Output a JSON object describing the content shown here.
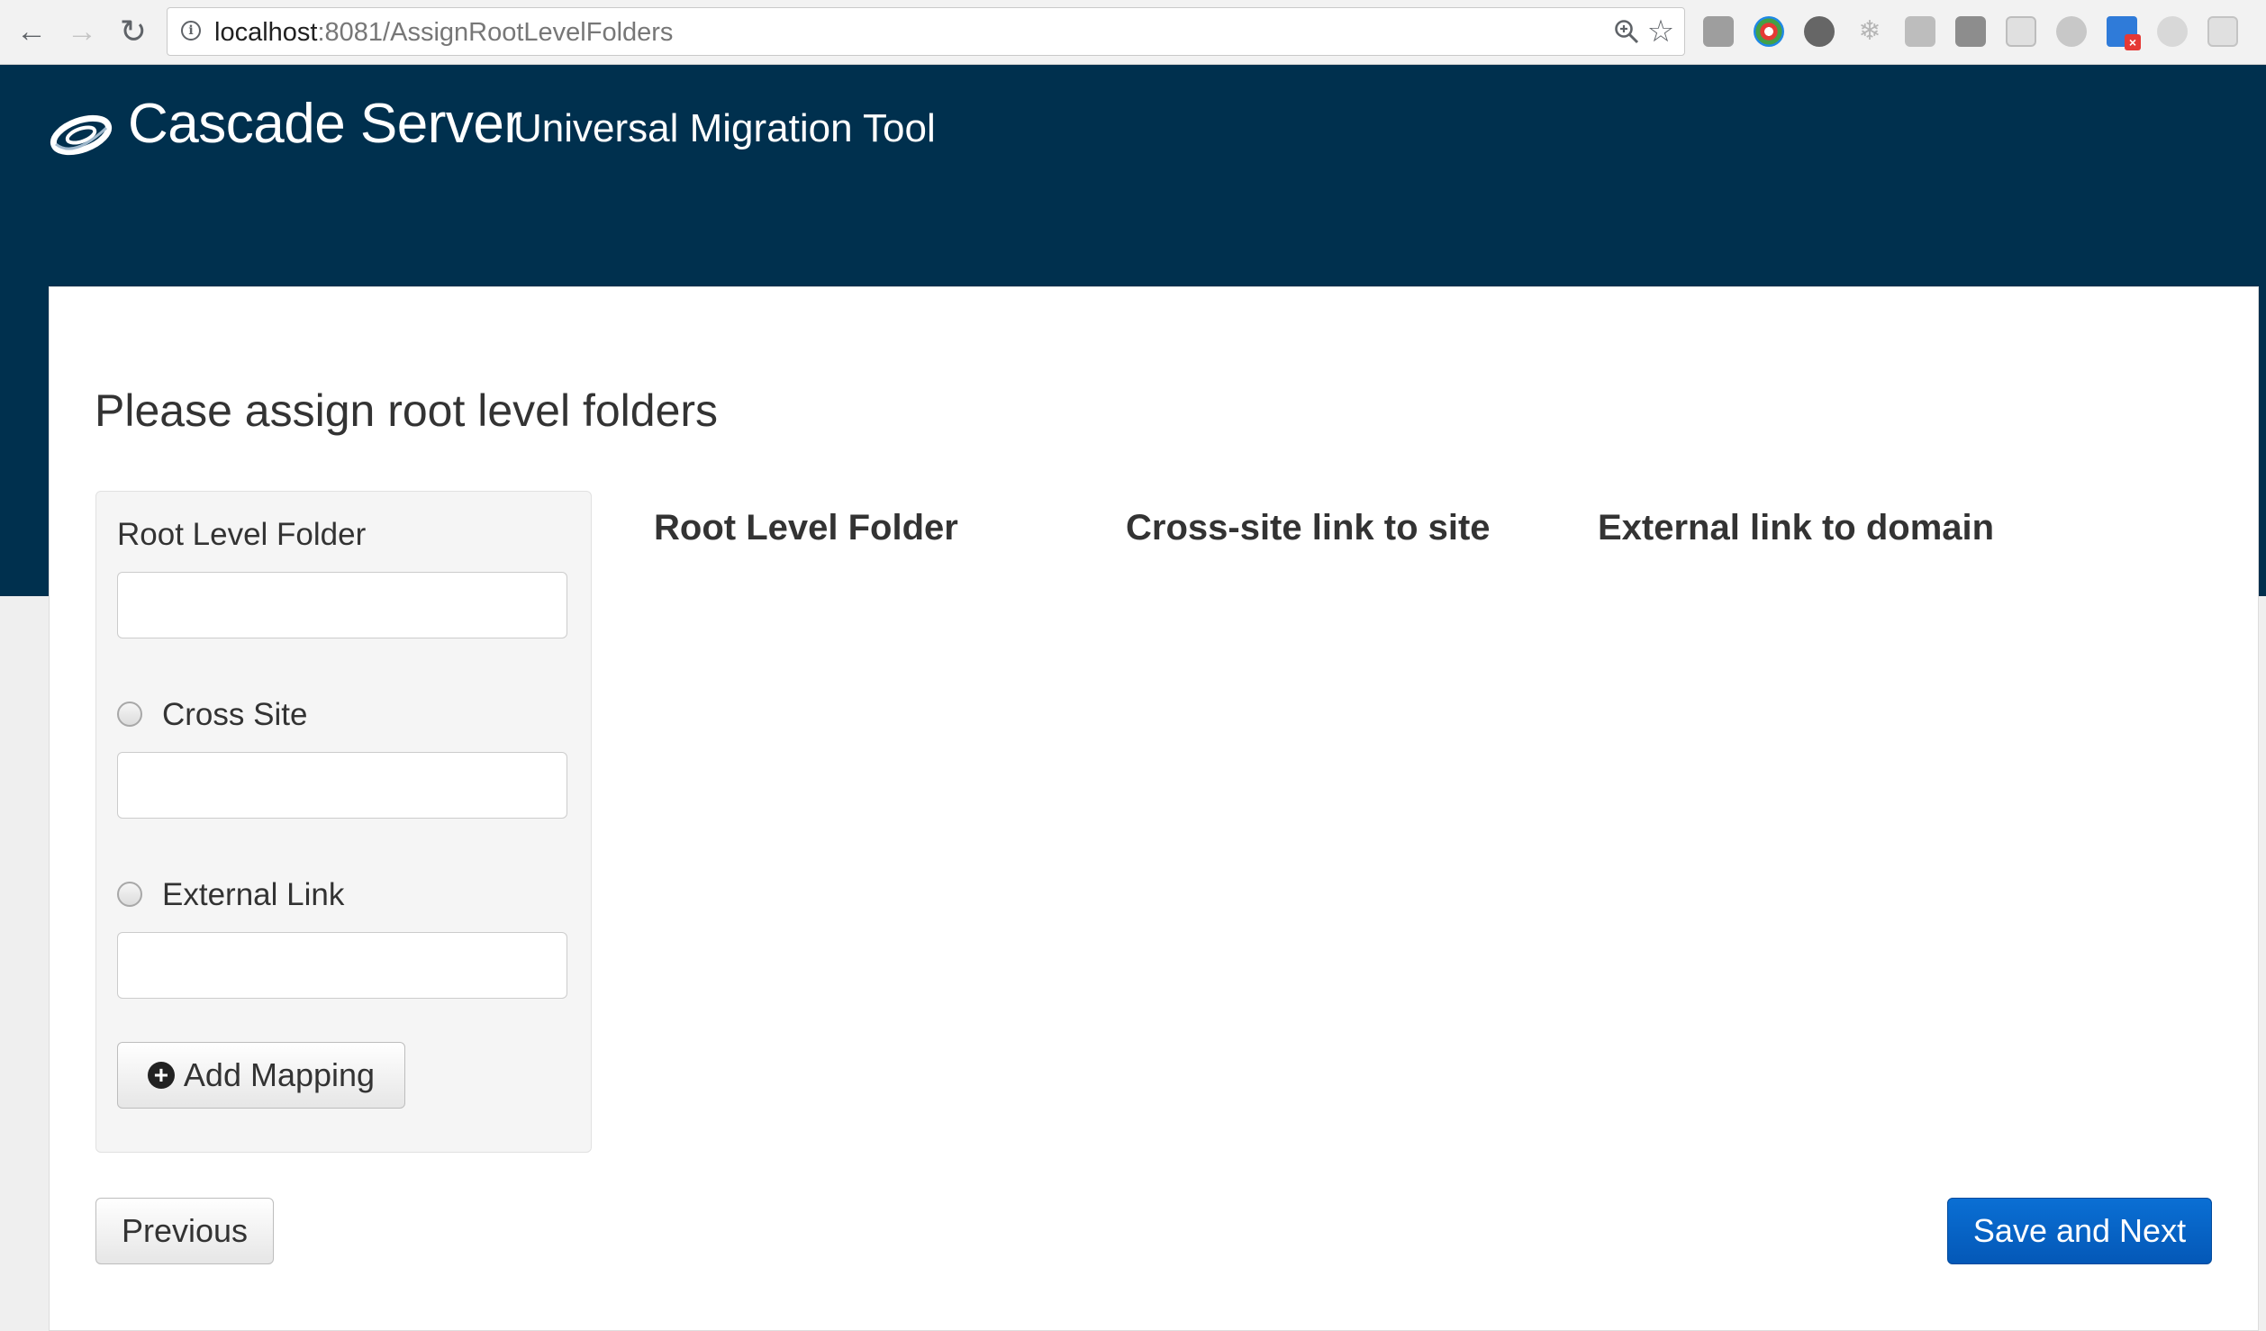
{
  "browser": {
    "url_host": "localhost",
    "url_path": ":8081/AssignRootLevelFolders",
    "icons": [
      "back-arrow-icon",
      "forward-arrow-icon",
      "reload-icon",
      "info-icon",
      "zoom-icon",
      "bookmark-star-icon"
    ],
    "extension_icons": [
      "camera-icon",
      "color-picker-icon",
      "globe-icon",
      "snowflake-icon",
      "extension-icon",
      "extension-icon",
      "extension-icon",
      "extension-icon",
      "screen-icon",
      "extension-icon",
      "extension-icon"
    ]
  },
  "header": {
    "brand": "Cascade Server",
    "subtitle": "Universal Migration Tool",
    "background_color": "#00304e"
  },
  "page": {
    "title": "Please assign root level folders"
  },
  "form": {
    "root_folder_label": "Root Level Folder",
    "root_folder_value": "",
    "cross_site_label": "Cross Site",
    "cross_site_value": "",
    "external_link_label": "External Link",
    "external_link_value": "",
    "add_mapping_label": "Add Mapping"
  },
  "table": {
    "headers": [
      "Root Level Folder",
      "Cross-site link to site",
      "External link to domain"
    ],
    "rows": []
  },
  "actions": {
    "previous_label": "Previous",
    "next_label": "Save and Next",
    "primary_color": "#0a63c9"
  }
}
